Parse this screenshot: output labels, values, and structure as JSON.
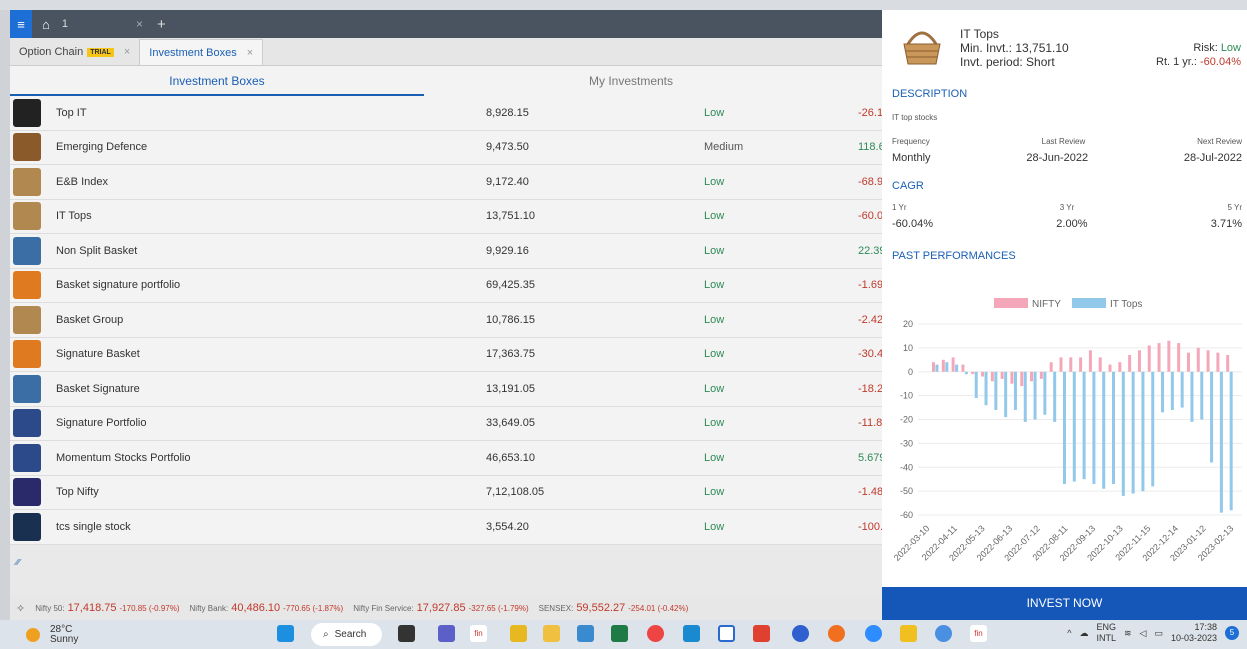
{
  "tabs": {
    "home_tab": "1",
    "sub": [
      {
        "label": "Option Chain",
        "badge": "TRIAL"
      },
      {
        "label": "Investment Boxes"
      }
    ]
  },
  "subtabs": [
    "Investment Boxes",
    "My Investments"
  ],
  "rows": [
    {
      "name": "Top IT",
      "value": "8,928.15",
      "risk": "Low",
      "ret": "-26.1",
      "icon": "top-it-logo-icon",
      "color": "#222"
    },
    {
      "name": "Emerging Defence",
      "value": "9,473.50",
      "risk": "Medium",
      "ret": "118.6",
      "icon": "defence-emblem-icon",
      "color": "#8a5a2b"
    },
    {
      "name": "E&B Index",
      "value": "9,172.40",
      "risk": "Low",
      "ret": "-68.9",
      "icon": "basket-icon",
      "color": "#b08850"
    },
    {
      "name": "IT Tops",
      "value": "13,751.10",
      "risk": "Low",
      "ret": "-60.0",
      "icon": "basket-icon",
      "color": "#b08850"
    },
    {
      "name": "Non Split Basket",
      "value": "9,929.16",
      "risk": "Low",
      "ret": "22.39",
      "icon": "landscape-icon",
      "color": "#3a6ea5"
    },
    {
      "name": "Basket signature portfolio",
      "value": "69,425.35",
      "risk": "Low",
      "ret": "-1.69",
      "icon": "orange-leaf-icon",
      "color": "#e07a20"
    },
    {
      "name": "Basket Group",
      "value": "10,786.15",
      "risk": "Low",
      "ret": "-2.42",
      "icon": "basket-icon",
      "color": "#b08850"
    },
    {
      "name": "Signature Basket",
      "value": "17,363.75",
      "risk": "Low",
      "ret": "-30.4",
      "icon": "orange-leaf-icon",
      "color": "#e07a20"
    },
    {
      "name": "Basket Signature",
      "value": "13,191.05",
      "risk": "Low",
      "ret": "-18.2",
      "icon": "landscape-icon",
      "color": "#3a6ea5"
    },
    {
      "name": "Signature Portfolio",
      "value": "33,649.05",
      "risk": "Low",
      "ret": "-11.8",
      "icon": "check-circle-icon",
      "color": "#2c4a8a"
    },
    {
      "name": "Momentum Stocks Portfolio",
      "value": "46,653.10",
      "risk": "Low",
      "ret": "5.679",
      "icon": "check-circle-icon",
      "color": "#2c4a8a"
    },
    {
      "name": "Top Nifty",
      "value": "7,12,108.05",
      "risk": "Low",
      "ret": "-1.48",
      "icon": "n-logo-icon",
      "color": "#2a2a6a"
    },
    {
      "name": "tcs single stock",
      "value": "3,554.20",
      "risk": "Low",
      "ret": "-100.",
      "icon": "stock-chart-icon",
      "color": "#1a3050"
    }
  ],
  "tickers": [
    {
      "name": "Nifty 50:",
      "value": "17,418.75",
      "change": "-170.85 (-0.97%)"
    },
    {
      "name": "Nifty Bank:",
      "value": "40,486.10",
      "change": "-770.65 (-1.87%)"
    },
    {
      "name": "Nifty Fin Service:",
      "value": "17,927.85",
      "change": "-327.65 (-1.79%)"
    },
    {
      "name": "SENSEX:",
      "value": "59,552.27",
      "change": "-254.01 (-0.42%)"
    }
  ],
  "panel": {
    "title": "IT Tops",
    "min_invt": "Min. Invt.: 13,751.10",
    "period": "Invt. period: Short",
    "risk_label": "Risk: ",
    "risk": "Low",
    "ret_label": "Rt. 1 yr.: ",
    "ret": "-60.04%",
    "desc_head": "DESCRIPTION",
    "desc": "IT top stocks",
    "freq_label": "Frequency",
    "last_label": "Last Review",
    "next_label": "Next Review",
    "freq": "Monthly",
    "last": "28-Jun-2022",
    "next": "28-Jul-2022",
    "cagr_head": "CAGR",
    "y1_label": "1 Yr",
    "y3_label": "3 Yr",
    "y5_label": "5 Yr",
    "y1": "-60.04%",
    "y3": "2.00%",
    "y5": "3.71%",
    "perf_head": "PAST PERFORMANCES",
    "invest": "INVEST NOW"
  },
  "chart_data": {
    "type": "bar",
    "series": [
      {
        "name": "NIFTY",
        "color": "#f4a7b9",
        "values": [
          4,
          5,
          6,
          3,
          -1,
          -2,
          -4,
          -3,
          -5,
          -6,
          -4,
          -3,
          4,
          6,
          6,
          6,
          9,
          6,
          3,
          4,
          7,
          9,
          11,
          12,
          13,
          12,
          8,
          10,
          9,
          8,
          7
        ]
      },
      {
        "name": "IT Tops",
        "color": "#92c8ea",
        "values": [
          3,
          4,
          3,
          -1,
          -11,
          -14,
          -16,
          -19,
          -16,
          -21,
          -20,
          -18,
          -21,
          -47,
          -46,
          -45,
          -47,
          -49,
          -47,
          -52,
          -51,
          -50,
          -48,
          -17,
          -16,
          -15,
          -21,
          -20,
          -38,
          -59,
          -58
        ]
      }
    ],
    "x_ticks": [
      "2022-03-10",
      "2022-04-11",
      "2022-05-13",
      "2022-06-13",
      "2022-07-12",
      "2022-08-11",
      "2022-09-13",
      "2022-10-13",
      "2022-11-15",
      "2022-12-14",
      "2023-01-12",
      "2023-02-13"
    ],
    "y_ticks": [
      "20",
      "10",
      "0",
      "-10",
      "-20",
      "-30",
      "-40",
      "-50",
      "-60"
    ],
    "ylim": [
      -60,
      20
    ]
  },
  "taskbar": {
    "temp": "28°C",
    "weather": "Sunny",
    "search": "Search",
    "lang": "ENG",
    "region": "INTL",
    "time": "17:38",
    "date": "10-03-2023",
    "notif": "5"
  }
}
